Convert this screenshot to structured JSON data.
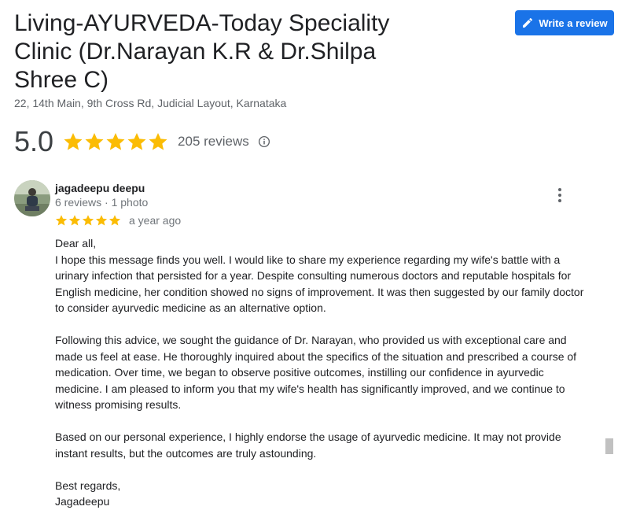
{
  "business": {
    "name": "Living-AYURVEDA-Today Speciality Clinic (Dr.Narayan K.R & Dr.Shilpa Shree C)",
    "address": "22, 14th Main, 9th Cross Rd, Judicial Layout, Karnataka"
  },
  "write_review": {
    "label": "Write a review",
    "icon": "pencil-icon"
  },
  "summary": {
    "rating": "5.0",
    "stars": 5,
    "reviews_label": "205 reviews",
    "star_color": "#fbbc04",
    "info_icon": "info-icon"
  },
  "review": {
    "author": "jagadeepu deepu",
    "meta": "6 reviews · 1 photo",
    "stars": 5,
    "time": "a year ago",
    "more_icon": "more-vert-icon",
    "lines": [
      "Dear all,",
      "I hope this message finds you well. I would like to share my experience regarding my wife's battle with a urinary infection that persisted for a year. Despite consulting numerous doctors and reputable hospitals for English medicine, her condition showed no signs of improvement. It was then suggested by our family doctor to consider ayurvedic medicine as an alternative option.",
      "",
      "Following this advice, we sought the guidance of Dr. Narayan, who provided us with exceptional care and made us feel at ease. He thoroughly inquired about the specifics of the situation and prescribed a course of medication. Over time, we began to observe positive outcomes, instilling our confidence in ayurvedic medicine. I am pleased to inform you that my wife's health has significantly improved, and we continue to witness promising results.",
      "",
      "Based on our personal experience, I highly endorse the usage of ayurvedic medicine. It may not provide instant results, but the outcomes are truly astounding.",
      "",
      "Best regards,",
      "Jagadeepu"
    ]
  },
  "colors": {
    "accent": "#1a73e8",
    "star": "#fbbc04",
    "secondary_text": "#70757a"
  }
}
